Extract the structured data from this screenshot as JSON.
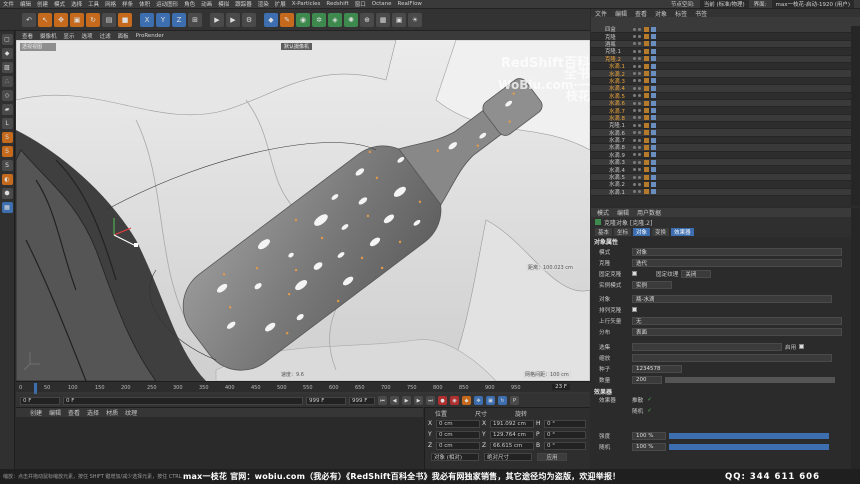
{
  "menubar": {
    "items": [
      "文件",
      "编辑",
      "创建",
      "模式",
      "选择",
      "工具",
      "网格",
      "样条",
      "体积",
      "运动图形",
      "角色",
      "动画",
      "模拟",
      "跟踪器",
      "渲染",
      "扩展",
      "X-Particles",
      "Redshift",
      "窗口",
      "Octane",
      "RealFlow"
    ],
    "layout_label": "节点空间:",
    "layout_value": "当前 (标准/物理)",
    "interface_label": "界面:",
    "interface_value": "max一枝花-启动-1920 (用户)"
  },
  "viewport": {
    "menu": [
      "查看",
      "摄像机",
      "显示",
      "选项",
      "过滤",
      "面板",
      "ProRender"
    ],
    "camera_label": "默认摄像机",
    "speed_label": "速度：9.6",
    "grid_label": "网格间距：100 cm",
    "dist_label": "距离：100.023 cm",
    "frame_label": "0"
  },
  "watermark": {
    "line1": "RedShift百科全书",
    "line2": "WoBiu.com·一枝花"
  },
  "timeline": {
    "ticks": [
      "0",
      "50",
      "100",
      "150",
      "200",
      "250",
      "300",
      "350",
      "400",
      "450",
      "500",
      "550",
      "600",
      "650",
      "700",
      "750",
      "800",
      "850",
      "900",
      "950"
    ],
    "current_frame": "23 F"
  },
  "transport": {
    "start": "0 F",
    "start2": "0 F",
    "end": "999 F",
    "end2": "999 F"
  },
  "materials": {
    "menu": [
      "创建",
      "编辑",
      "查看",
      "选择",
      "材质",
      "纹理"
    ]
  },
  "coords": {
    "headers": [
      "位置",
      "尺寸",
      "旋转"
    ],
    "rows": [
      {
        "axis": "X",
        "pos": "0 cm",
        "size": "191.092 cm",
        "rl": "H",
        "rot": "0 °"
      },
      {
        "axis": "Y",
        "pos": "0 cm",
        "size": "129.764 cm",
        "rl": "P",
        "rot": "0 °"
      },
      {
        "axis": "Z",
        "pos": "0 cm",
        "size": "66.615 cm",
        "rl": "B",
        "rot": "0 °"
      }
    ],
    "mode": "对象 (相对)",
    "size_mode": "绝对尺寸",
    "apply": "应用"
  },
  "objects": {
    "menu": [
      "文件",
      "编辑",
      "查看",
      "对象",
      "标签",
      "书签"
    ],
    "rows": [
      {
        "name": "四盒",
        "sel": false
      },
      {
        "name": "克隆",
        "sel": false
      },
      {
        "name": "酒瓶",
        "sel": false
      },
      {
        "name": "克隆.1",
        "sel": false
      },
      {
        "name": "克隆.2",
        "sel": true
      },
      {
        "name": "水滴.1",
        "sel": true
      },
      {
        "name": "水滴.2",
        "sel": true
      },
      {
        "name": "水滴.3",
        "sel": true
      },
      {
        "name": "水滴.4",
        "sel": true
      },
      {
        "name": "水滴.5",
        "sel": true
      },
      {
        "name": "水滴.6",
        "sel": true
      },
      {
        "name": "水滴.7",
        "sel": true
      },
      {
        "name": "水滴.8",
        "sel": true
      },
      {
        "name": "克隆.1",
        "sel": false
      },
      {
        "name": "水滴.6",
        "sel": false
      },
      {
        "name": "水滴.7",
        "sel": false
      },
      {
        "name": "水滴.8",
        "sel": false
      },
      {
        "name": "水滴.9",
        "sel": false
      },
      {
        "name": "水滴.3",
        "sel": false
      },
      {
        "name": "水滴.4",
        "sel": false
      },
      {
        "name": "水滴.5",
        "sel": false
      },
      {
        "name": "水滴.2",
        "sel": false
      },
      {
        "name": "水滴.1",
        "sel": false
      }
    ]
  },
  "attributes": {
    "menu": [
      "模式",
      "编辑",
      "用户数据"
    ],
    "title": "克隆对象 [克隆.2]",
    "tabs": [
      "基本",
      "坐标",
      "对象",
      "变换",
      "效果器"
    ],
    "active_tab": "对象",
    "section1": "对象属性",
    "rows": [
      {
        "k": "模式",
        "v": "对象"
      },
      {
        "k": "克隆",
        "v": "迭代"
      },
      {
        "k": "固定克隆",
        "v": "固定纹理"
      },
      {
        "k": "实例模式",
        "v": "实例"
      },
      {
        "k": "对象",
        "v": "瓶-水滴"
      },
      {
        "k": "排列克隆",
        "v": ""
      },
      {
        "k": "上行矢量",
        "v": "无"
      },
      {
        "k": "分布",
        "v": "表面"
      }
    ],
    "sel_label": "选集",
    "enable_label": "启用",
    "scale_label": "缩放",
    "seed_label": "种子",
    "seed": "1234578",
    "count_label": "数量",
    "count": "200",
    "section2": "效果器",
    "effector_label": "效果器",
    "eff_items": [
      "推散",
      "随机"
    ],
    "weight_label": "强度",
    "weight": "100 %",
    "random_label": "随机",
    "random": "100 %"
  },
  "status": {
    "text": "缩放：点击并拖动鼠标缩放元素，按住 SHIFT 键增加/减少选择元素，按住 CTRL 键减少选择元素。",
    "banner": "max一枝花 官网：wobiu.com（我必有）《RedShift百科全书》我必有网独家销售，其它途径均为盗版，欢迎举报！",
    "qq": "QQ: 344 611 606"
  }
}
